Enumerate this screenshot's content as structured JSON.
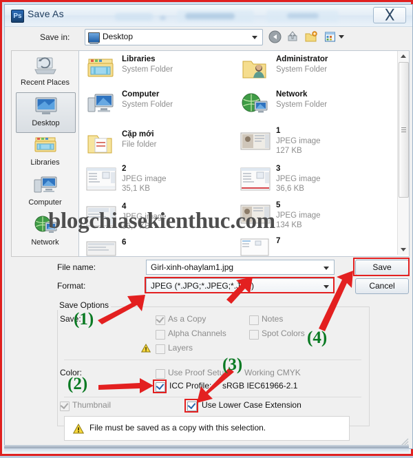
{
  "window": {
    "title": "Save As",
    "app_icon": "Ps",
    "close_label": "✕"
  },
  "toolbar": {
    "save_in_label": "Save in:",
    "save_in_value": "Desktop",
    "icons": [
      "back-icon",
      "up-folder-icon",
      "new-folder-icon",
      "views-icon"
    ]
  },
  "places": {
    "items": [
      {
        "label": "Recent Places",
        "icon": "recent-places-icon",
        "selected": false
      },
      {
        "label": "Desktop",
        "icon": "desktop-icon",
        "selected": true
      },
      {
        "label": "Libraries",
        "icon": "libraries-icon",
        "selected": false
      },
      {
        "label": "Computer",
        "icon": "computer-icon",
        "selected": false
      },
      {
        "label": "Network",
        "icon": "network-icon",
        "selected": false
      }
    ]
  },
  "files": [
    {
      "name": "Libraries",
      "type": "System Folder",
      "size": "",
      "icon": "libraries-folder-icon"
    },
    {
      "name": "Administrator",
      "type": "System Folder",
      "size": "",
      "icon": "user-folder-icon"
    },
    {
      "name": "Computer",
      "type": "System Folder",
      "size": "",
      "icon": "computer-icon"
    },
    {
      "name": "Network",
      "type": "System Folder",
      "size": "",
      "icon": "network-icon"
    },
    {
      "name": "Cặp mới",
      "type": "File folder",
      "size": "",
      "icon": "folder-icon"
    },
    {
      "name": "1",
      "type": "JPEG image",
      "size": "127 KB",
      "icon": "image-thumb"
    },
    {
      "name": "2",
      "type": "JPEG image",
      "size": "35,1 KB",
      "icon": "image-thumb"
    },
    {
      "name": "3",
      "type": "JPEG image",
      "size": "36,6 KB",
      "icon": "image-thumb"
    },
    {
      "name": "4",
      "type": "JPEG image",
      "size": "36,7 KB",
      "icon": "image-thumb"
    },
    {
      "name": "5",
      "type": "JPEG image",
      "size": "134 KB",
      "icon": "image-thumb"
    },
    {
      "name": "6",
      "type": "",
      "size": "",
      "icon": "image-thumb"
    },
    {
      "name": "7",
      "type": "",
      "size": "",
      "icon": "image-thumb"
    }
  ],
  "watermark": "blogchiasekienthuc.com",
  "form": {
    "file_name_label": "File name:",
    "file_name_value": "Girl-xinh-ohaylam1.jpg",
    "format_label": "Format:",
    "format_value": "JPEG (*.JPG;*.JPEG;*.JPE)",
    "save_button": "Save",
    "cancel_button": "Cancel"
  },
  "save_options": {
    "group_title": "Save Options",
    "save_label": "Save:",
    "checkboxes": [
      {
        "label": "As a Copy",
        "checked": true,
        "disabled": true
      },
      {
        "label": "Notes",
        "checked": false,
        "disabled": true
      },
      {
        "label": "Alpha Channels",
        "checked": false,
        "disabled": true
      },
      {
        "label": "Spot Colors",
        "checked": false,
        "disabled": true
      },
      {
        "label": "Layers",
        "checked": false,
        "disabled": true
      }
    ],
    "color_label": "Color:",
    "proof_label": "Use Proof Setup:",
    "proof_value": "Working CMYK",
    "proof_checked": false,
    "icc_label": "ICC Profile:",
    "icc_value": "sRGB IEC61966-2.1",
    "icc_checked": true,
    "thumbnail_label": "Thumbnail",
    "thumbnail_checked": true,
    "lowercase_label": "Use Lower Case Extension",
    "lowercase_checked": true
  },
  "notice": {
    "text": "File must be saved as a copy with this selection."
  },
  "annotations": {
    "markers": [
      "(1)",
      "(2)",
      "(3)",
      "(4)"
    ],
    "marker_color": "#0a7a23",
    "arrow_color": "#e32020",
    "highlight_color": "#e32020"
  }
}
